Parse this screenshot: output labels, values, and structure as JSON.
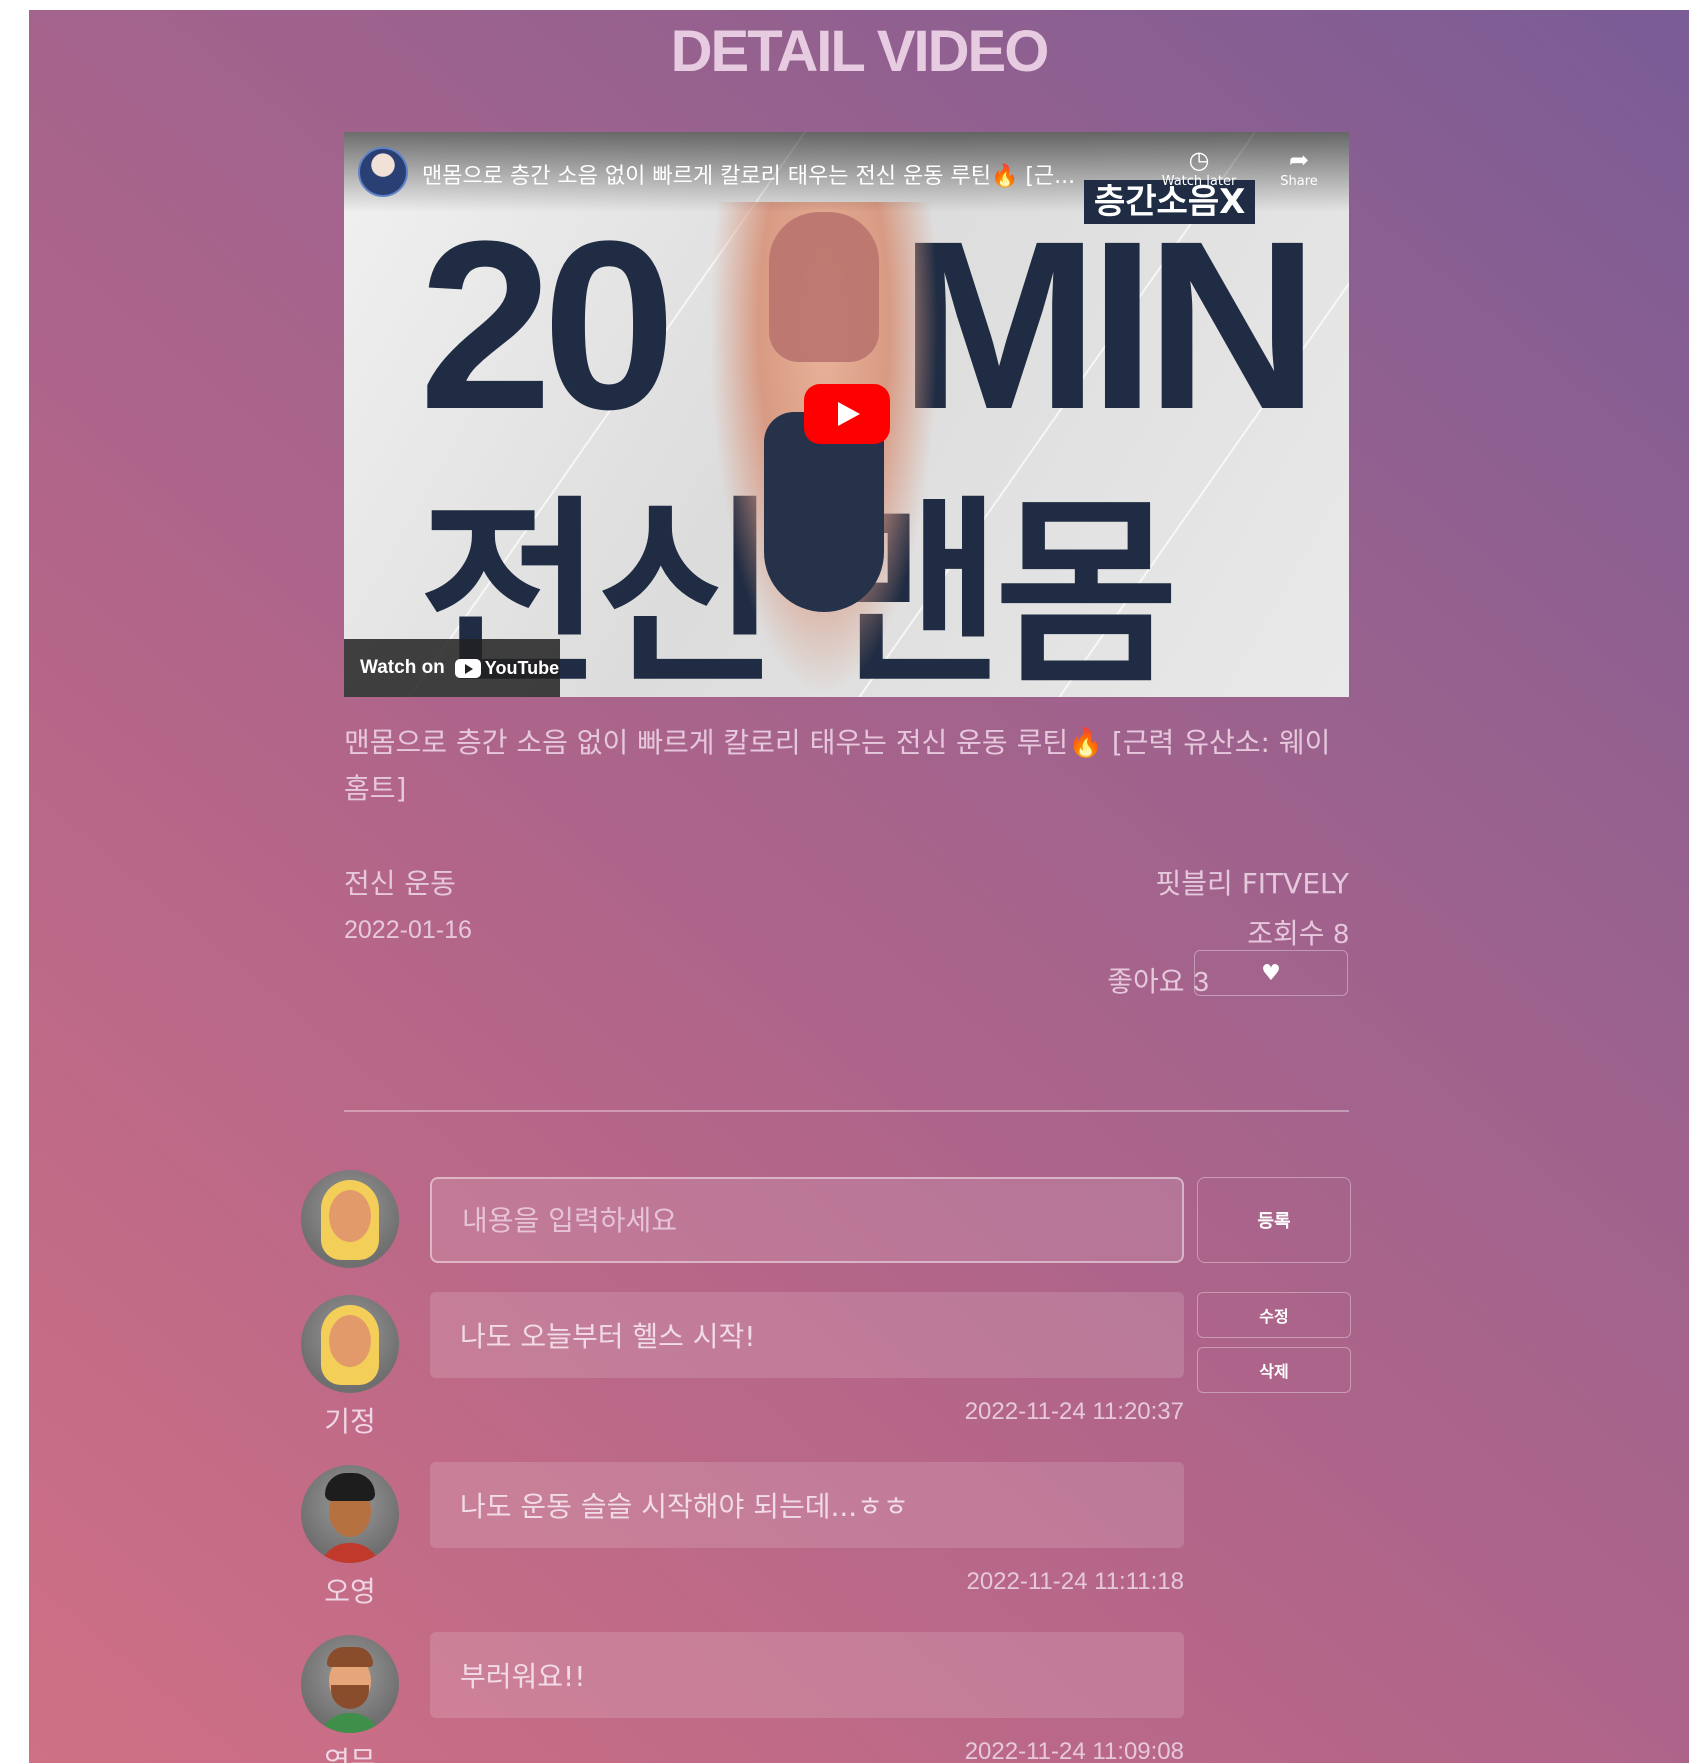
{
  "page": {
    "title": "DETAIL VIDEO"
  },
  "video": {
    "embed_title": "맨몸으로 층간 소음 없이 빠르게 칼로리 태우는 전신 운동 루틴🔥 [근...",
    "watch_later_label": "Watch later",
    "share_label": "Share",
    "thumbnail_text": {
      "big_number": "20",
      "big_unit": "MIN",
      "korean": "전신 맨몸",
      "badge": "층간소음X"
    },
    "watch_on_label": "Watch on",
    "youtube_label": "YouTube"
  },
  "details": {
    "description": "맨몸으로 층간 소음 없이 빠르게 칼로리 태우는 전신 운동 루틴🔥 [근력 유산소: 웨이홈트]",
    "category": "전신 운동",
    "date": "2022-01-16",
    "channel": "핏블리 FITVELY",
    "views_label": "조회수",
    "views_count": "8",
    "likes_label": "좋아요",
    "likes_count": "3",
    "like_button_glyph": "♥"
  },
  "comment_form": {
    "placeholder": "내용을 입력하세요",
    "submit_label": "등록"
  },
  "comments": [
    {
      "author": "기정",
      "text": "나도 오늘부터 헬스 시작!",
      "timestamp": "2022-11-24 11:20:37",
      "edit_label": "수정",
      "delete_label": "삭제"
    },
    {
      "author": "오영",
      "text": "나도 운동 슬슬 시작해야 되는데...ㅎㅎ",
      "timestamp": "2022-11-24 11:11:18"
    },
    {
      "author": "영무",
      "text": "부러워요!!",
      "timestamp": "2022-11-24 11:09:08"
    }
  ],
  "colors": {
    "accent_text": "#e6c8dc",
    "gradient_start": "#cf7085",
    "gradient_end": "#7a5c96",
    "youtube_red": "#ff0000"
  }
}
